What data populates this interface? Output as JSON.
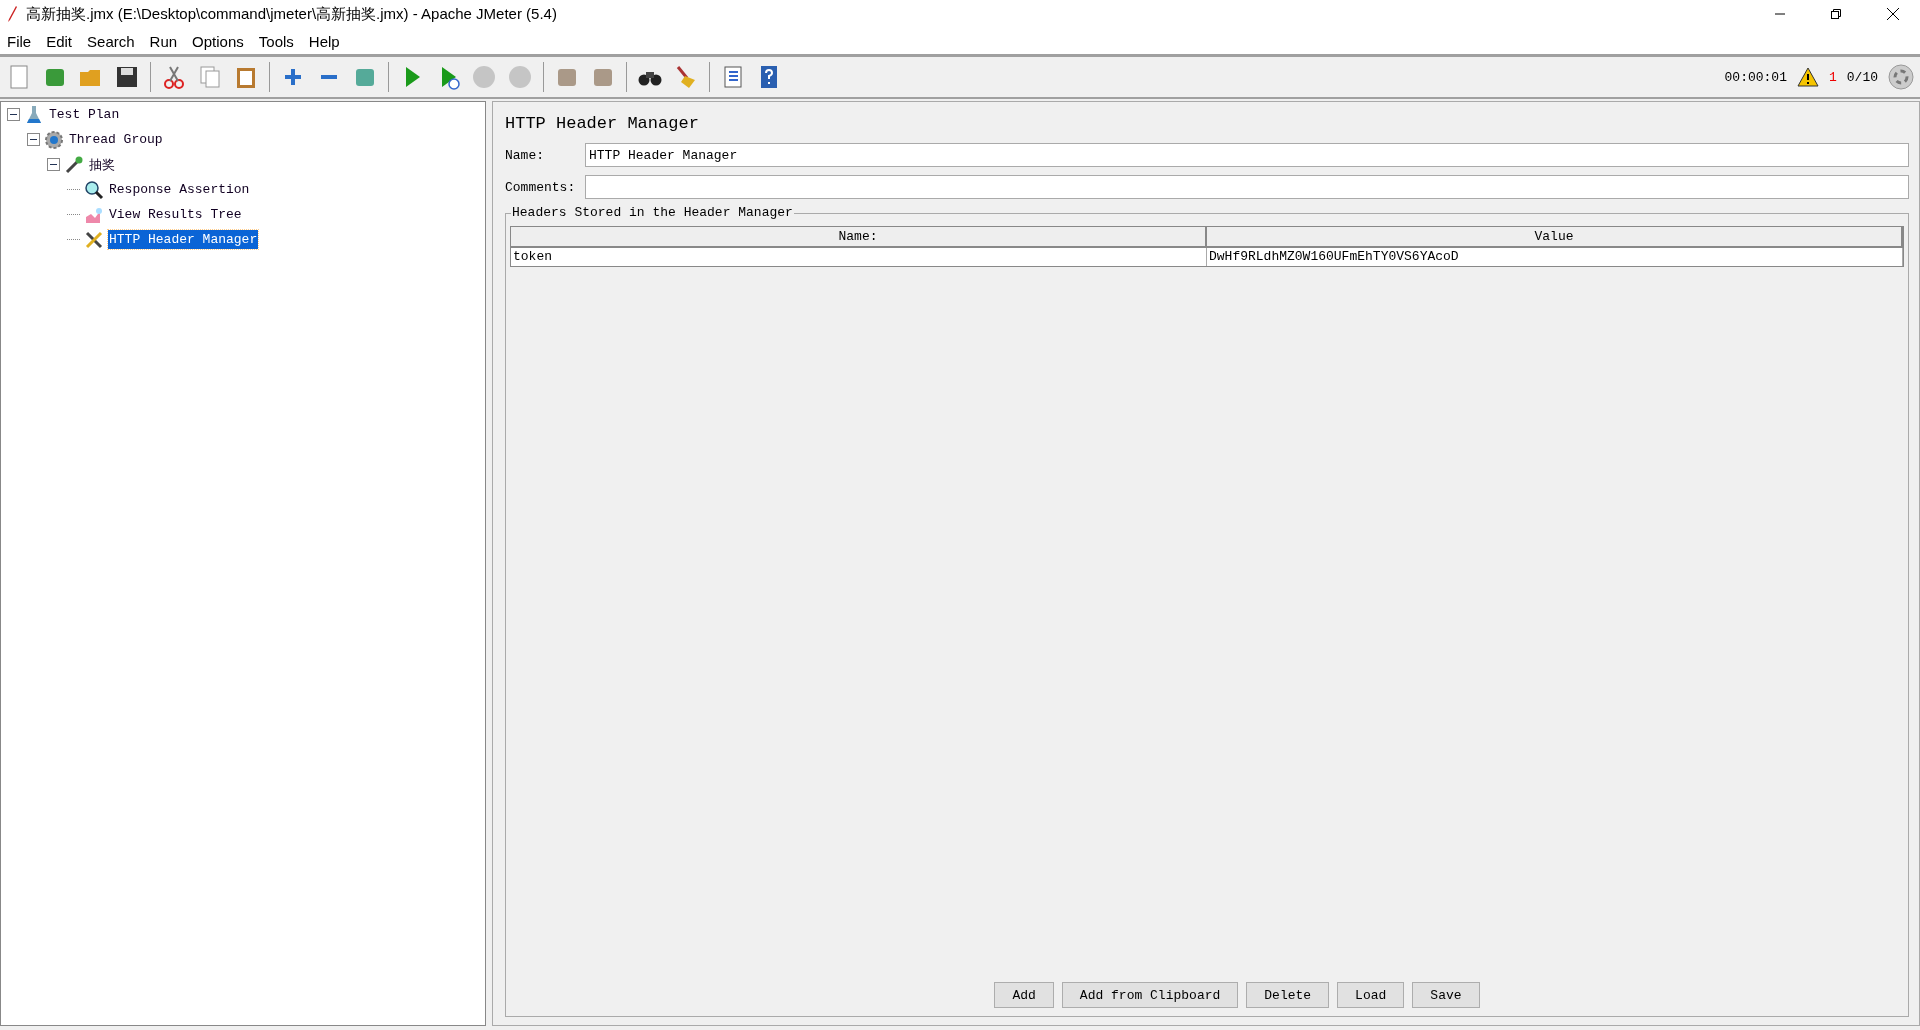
{
  "window": {
    "title": "高新抽奖.jmx (E:\\Desktop\\command\\jmeter\\高新抽奖.jmx) - Apache JMeter (5.4)"
  },
  "menu": [
    "File",
    "Edit",
    "Search",
    "Run",
    "Options",
    "Tools",
    "Help"
  ],
  "toolbar": [
    {
      "kind": "new",
      "disabled": false
    },
    {
      "kind": "templates",
      "disabled": false
    },
    {
      "kind": "open",
      "disabled": false
    },
    {
      "kind": "save",
      "disabled": false
    },
    {
      "kind": "sep"
    },
    {
      "kind": "cut",
      "disabled": false
    },
    {
      "kind": "copy",
      "disabled": false
    },
    {
      "kind": "paste",
      "disabled": false
    },
    {
      "kind": "sep"
    },
    {
      "kind": "expand",
      "disabled": false
    },
    {
      "kind": "collapse",
      "disabled": false
    },
    {
      "kind": "toggle",
      "disabled": false
    },
    {
      "kind": "sep"
    },
    {
      "kind": "start",
      "disabled": false
    },
    {
      "kind": "start-no-pause",
      "disabled": false
    },
    {
      "kind": "stop",
      "disabled": true
    },
    {
      "kind": "shutdown",
      "disabled": true
    },
    {
      "kind": "sep"
    },
    {
      "kind": "clear",
      "disabled": false
    },
    {
      "kind": "clear-all",
      "disabled": false
    },
    {
      "kind": "sep"
    },
    {
      "kind": "search",
      "disabled": false
    },
    {
      "kind": "reset-search",
      "disabled": false
    },
    {
      "kind": "sep"
    },
    {
      "kind": "functions",
      "disabled": false
    },
    {
      "kind": "help",
      "disabled": false
    }
  ],
  "status": {
    "elapsed": "00:00:01",
    "warnings": "1",
    "threads": "0/10"
  },
  "tree": [
    {
      "label": "Test Plan",
      "kind": "plan",
      "expanded": true,
      "selected": false,
      "children": [
        {
          "label": "Thread Group",
          "kind": "threads",
          "expanded": true,
          "selected": false,
          "children": [
            {
              "label": "抽奖",
              "kind": "sampler",
              "expanded": true,
              "selected": false,
              "children": [
                {
                  "label": "Response Assertion",
                  "kind": "assertion",
                  "selected": false
                },
                {
                  "label": "View Results Tree",
                  "kind": "listener",
                  "selected": false
                },
                {
                  "label": "HTTP Header Manager",
                  "kind": "config",
                  "selected": true
                }
              ]
            }
          ]
        }
      ]
    }
  ],
  "panel": {
    "title": "HTTP Header Manager",
    "name_label": "Name:",
    "name_value": "HTTP Header Manager",
    "comments_label": "Comments:",
    "group_title": "Headers Stored in the Header Manager",
    "table": {
      "columns": [
        "Name:",
        "Value"
      ],
      "rows": [
        [
          "token",
          "DwHf9RLdhMZ0W160UFmEhTY0VS6YAcoD"
        ]
      ]
    },
    "buttons": [
      "Add",
      "Add from Clipboard",
      "Delete",
      "Load",
      "Save"
    ]
  }
}
